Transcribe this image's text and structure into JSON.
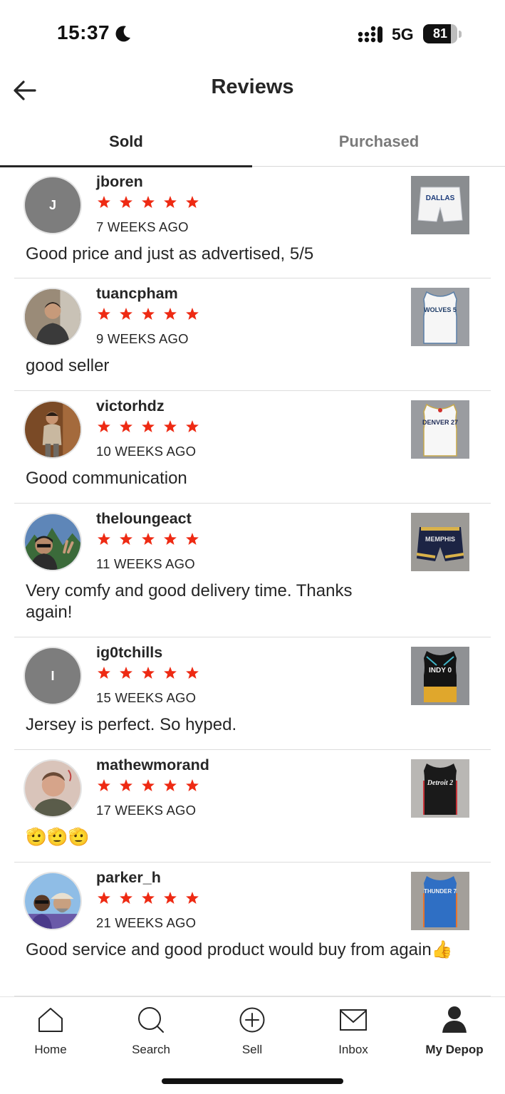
{
  "status_bar": {
    "time": "15:37",
    "network": "5G",
    "battery": "81",
    "battery_level": 0.81
  },
  "header": {
    "title": "Reviews",
    "back_icon": "arrow-left-icon"
  },
  "tabs": [
    {
      "label": "Sold",
      "active": true
    },
    {
      "label": "Purchased",
      "active": false
    }
  ],
  "colors": {
    "star": "#ee2a13",
    "text": "#262626",
    "muted_tab": "#7a7a7a",
    "avatar_placeholder": "#7d7d7d"
  },
  "reviews": [
    {
      "username": "jboren",
      "rating": 5,
      "time": "7 WEEKS AGO",
      "text": "Good price and just as advertised, 5/5",
      "avatar_initial": "J",
      "product_icon": "shorts-icon",
      "product_text": "DALLAS"
    },
    {
      "username": "tuancpham",
      "rating": 5,
      "time": "9 WEEKS AGO",
      "text": "good seller",
      "avatar_initial": "",
      "product_icon": "jersey-icon",
      "product_text": "WOLVES 5"
    },
    {
      "username": "victorhdz",
      "rating": 5,
      "time": "10 WEEKS AGO",
      "text": "Good communication",
      "avatar_initial": "",
      "product_icon": "jersey-icon",
      "product_text": "DENVER 27"
    },
    {
      "username": "theloungeact",
      "rating": 5,
      "time": "11 WEEKS AGO",
      "text": "Very comfy and good delivery time. Thanks again!",
      "avatar_initial": "",
      "product_icon": "shorts-icon",
      "product_text": "MEMPHIS"
    },
    {
      "username": "ig0tchills",
      "rating": 5,
      "time": "15 WEEKS AGO",
      "text": "Jersey is perfect. So hyped.",
      "avatar_initial": "I",
      "product_icon": "jersey-icon",
      "product_text": "INDY 0"
    },
    {
      "username": "mathewmorand",
      "rating": 5,
      "time": "17 WEEKS AGO",
      "text": "🫡🫡🫡",
      "avatar_initial": "",
      "product_icon": "jersey-icon",
      "product_text": "Detroit 2"
    },
    {
      "username": "parker_h",
      "rating": 5,
      "time": "21 WEEKS AGO",
      "text": "Good service and good product would buy from again👍",
      "avatar_initial": "",
      "product_icon": "jersey-icon",
      "product_text": "THUNDER 7"
    }
  ],
  "bottom_nav": [
    {
      "label": "Home",
      "icon": "home-icon",
      "active": false
    },
    {
      "label": "Search",
      "icon": "search-icon",
      "active": false
    },
    {
      "label": "Sell",
      "icon": "plus-circle-icon",
      "active": false
    },
    {
      "label": "Inbox",
      "icon": "mail-icon",
      "active": false
    },
    {
      "label": "My Depop",
      "icon": "person-icon",
      "active": true
    }
  ]
}
